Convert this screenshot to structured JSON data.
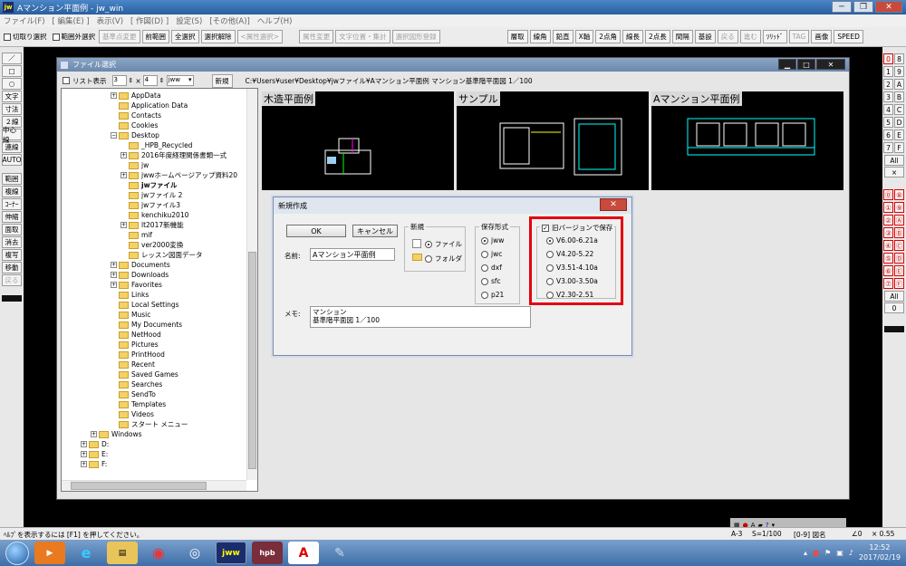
{
  "window": {
    "title": "Aマンション平面例 - jw_win",
    "app_icon": "jw"
  },
  "menu": [
    "ファイル(F)",
    "[ 編集(E) ]",
    "表示(V)",
    "[ 作図(D) ]",
    "設定(S)",
    "[その他(A)]",
    "ヘルプ(H)"
  ],
  "toolbar": {
    "checks": [
      "切取り選択",
      "範囲外選択"
    ],
    "buttons": [
      "基準点変更",
      "前範囲",
      "全選択",
      "選択解除",
      "<属性選択>",
      "属性変更",
      "文字位置・集計",
      "選択図形登録"
    ],
    "right_buttons": [
      "層取",
      "線角",
      "鉛直",
      "X軸",
      "2点角",
      "線長",
      "2点長",
      "間隔",
      "基設",
      "戻る",
      "進む",
      "ｿﾘｯﾄﾞ",
      "TAG",
      "画像",
      "SPEED"
    ]
  },
  "left_tools": [
    "／",
    "□",
    "○",
    "文字",
    "寸法",
    "２線",
    "中心線",
    "連線",
    "AUTO",
    "範囲",
    "複線",
    "ｺｰﾅｰ",
    "伸縮",
    "面取",
    "消去",
    "複写",
    "移動",
    "戻る"
  ],
  "right_tools": [
    "0",
    "8",
    "1",
    "9",
    "2",
    "A",
    "3",
    "B",
    "4",
    "C",
    "5",
    "D",
    "6",
    "E",
    "7",
    "F",
    "All",
    "×",
    "⓪",
    "⑧",
    "①",
    "⑨",
    "②",
    "Ⓐ",
    "③",
    "Ⓑ",
    "④",
    "Ⓒ",
    "⑤",
    "Ⓓ",
    "⑥",
    "Ⓔ",
    "⑦",
    "Ⓕ",
    "All",
    "0"
  ],
  "file_window": {
    "title": "ファイル選択",
    "list_label": "リスト表示",
    "spin1": "3",
    "times": "×",
    "spin2": "4",
    "ext": "jww",
    "new_button": "新規",
    "path": "C:¥Users¥user¥Desktop¥jwファイル¥Aマンション平面例  マンション基準階平面図  1／100",
    "tree": [
      "AppData",
      "Application Data",
      "Contacts",
      "Cookies",
      "Desktop",
      "_HPB_Recycled",
      "2016年度経理関係書類一式",
      "jw",
      "jwwホームページアップ資料20",
      "jwファイル",
      "jwファイル 2",
      "jwファイル3",
      "kenchiku2010",
      "lt2017新機能",
      "mif",
      "ver2000変換",
      "レッスン図面データ",
      "Documents",
      "Downloads",
      "Favorites",
      "Links",
      "Local Settings",
      "Music",
      "My Documents",
      "NetHood",
      "Pictures",
      "PrintHood",
      "Recent",
      "Saved Games",
      "Searches",
      "SendTo",
      "Templates",
      "Videos",
      "スタート メニュー",
      "Windows",
      "D:",
      "E:",
      "F:"
    ],
    "thumbs": [
      "木造平面例",
      "サンプル",
      "Aマンション平面例"
    ]
  },
  "dialog": {
    "title": "新規作成",
    "ok": "OK",
    "cancel": "キャンセル",
    "name_label": "名前:",
    "name_value": "Aマンション平面例",
    "new_group": "新規",
    "file_opt": "ファイル",
    "folder_opt": "フォルダ",
    "format_group": "保存形式",
    "formats": [
      "jww",
      "jwc",
      "dxf",
      "sfc",
      "p21"
    ],
    "old_version_label": "旧バージョンで保存",
    "old_version_checked": true,
    "versions": [
      "V6.00-6.21a",
      "V4.20-5.22",
      "V3.51-4.10a",
      "V3.00-3.50a",
      "V2.30-2.51"
    ],
    "memo_label": "メモ:",
    "memo_line1": "マンション",
    "memo_line2": "基準階平面図  1／100"
  },
  "status": {
    "help": "ﾍﾙﾌﾟを表示するには [F1] を押してください。",
    "paper": "A-3",
    "scale": "S=1/100",
    "layer": "[0-9] 図名",
    "angle": "∠0",
    "zoom": "× 0.55"
  },
  "taskbar": {
    "time": "12:52",
    "date": "2017/02/19"
  }
}
